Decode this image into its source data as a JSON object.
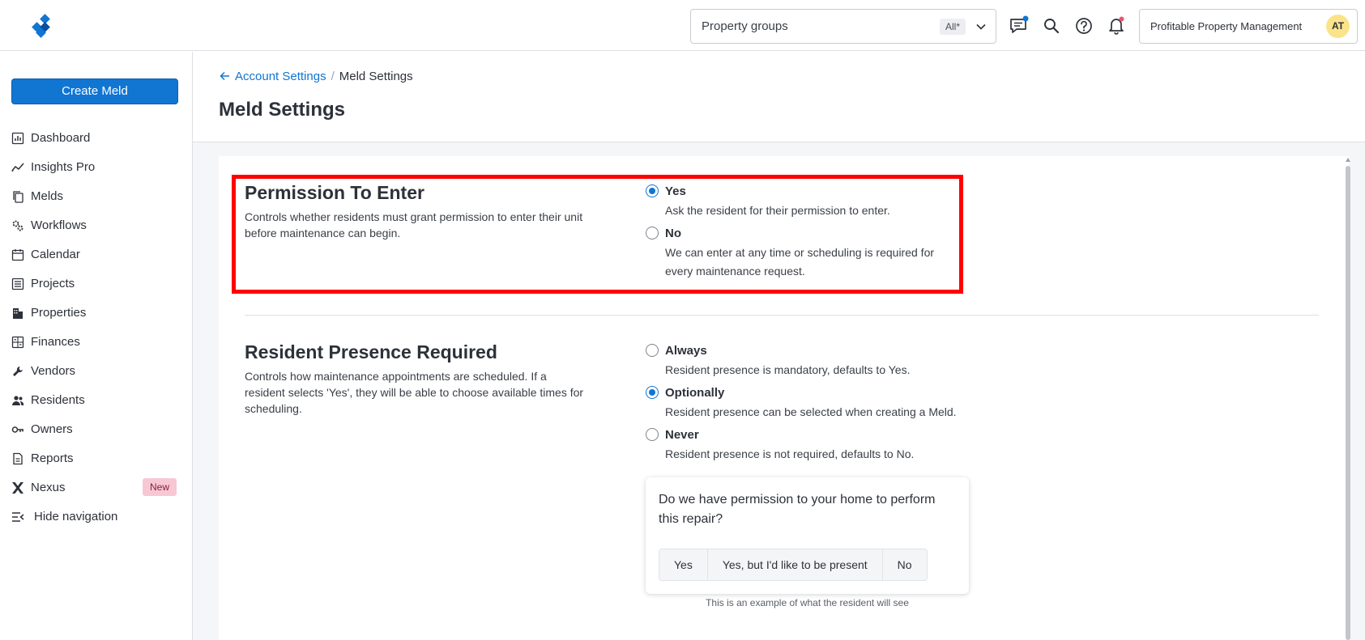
{
  "header": {
    "property_groups": {
      "label": "Property groups",
      "badge": "All*"
    },
    "organization": "Profitable Property Management",
    "avatar_initials": "AT",
    "colors": {
      "accent": "#1175d2",
      "notification_dot": "#e8556e"
    }
  },
  "sidebar": {
    "create_label": "Create Meld",
    "items": [
      {
        "label": "Dashboard",
        "icon": "dashboard-icon"
      },
      {
        "label": "Insights Pro",
        "icon": "chart-line-icon"
      },
      {
        "label": "Melds",
        "icon": "copy-icon"
      },
      {
        "label": "Workflows",
        "icon": "gears-icon"
      },
      {
        "label": "Calendar",
        "icon": "calendar-icon"
      },
      {
        "label": "Projects",
        "icon": "list-icon"
      },
      {
        "label": "Properties",
        "icon": "building-icon"
      },
      {
        "label": "Finances",
        "icon": "calculator-icon"
      },
      {
        "label": "Vendors",
        "icon": "wrench-icon"
      },
      {
        "label": "Residents",
        "icon": "people-icon"
      },
      {
        "label": "Owners",
        "icon": "key-icon"
      },
      {
        "label": "Reports",
        "icon": "document-icon"
      },
      {
        "label": "Nexus",
        "icon": "nexus-icon",
        "badge": "New"
      },
      {
        "label": "Hide navigation",
        "icon": "collapse-icon"
      }
    ]
  },
  "breadcrumb": {
    "back": "Account Settings",
    "current": "Meld Settings"
  },
  "page_title": "Meld Settings",
  "sections": {
    "permission": {
      "title": "Permission To Enter",
      "description": "Controls whether residents must grant permission to enter their unit before maintenance can begin.",
      "options": [
        {
          "label": "Yes",
          "desc": "Ask the resident for their permission to enter.",
          "selected": true
        },
        {
          "label": "No",
          "desc": "We can enter at any time or scheduling is required for every maintenance request.",
          "selected": false
        }
      ]
    },
    "presence": {
      "title": "Resident Presence Required",
      "description": "Controls how maintenance appointments are scheduled. If a resident selects 'Yes', they will be able to choose available times for scheduling.",
      "options": [
        {
          "label": "Always",
          "desc": "Resident presence is mandatory, defaults to Yes.",
          "selected": false
        },
        {
          "label": "Optionally",
          "desc": "Resident presence can be selected when creating a Meld.",
          "selected": true
        },
        {
          "label": "Never",
          "desc": "Resident presence is not required, defaults to No.",
          "selected": false
        }
      ]
    }
  },
  "preview": {
    "question": "Do we have permission to your home to perform this repair?",
    "buttons": [
      "Yes",
      "Yes, but I'd like to be present",
      "No"
    ],
    "note": "This is an example of what the resident will see"
  }
}
